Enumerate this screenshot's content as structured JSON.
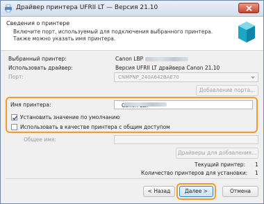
{
  "window": {
    "title": "Драйвер принтера UFRII LT — Версия 21.10"
  },
  "header": {
    "title": "Сведения о принтере",
    "description": "Включите порт, используемый для подключения выбранного принтера. Также можно указать имя принтера."
  },
  "info": {
    "selected_printer_label": "Выбранный принтер:",
    "selected_printer_value": "Canon LBP",
    "driver_label": "Использовать драйвер:",
    "driver_value": "Версия UFRII LT драйвера Canon 21.10",
    "port_label": "Порт:",
    "port_value": "CNMPNP_240A642BAE70",
    "add_port_button": "Добавление порта..."
  },
  "printer_name": {
    "label": "Имя принтера:",
    "value": "Canon LBP",
    "default_checkbox": "Установить значение по умолчанию",
    "default_checked": true,
    "shared_checkbox": "Использовать в качестве принтера с общим доступом",
    "shared_checked": false
  },
  "share": {
    "label": "Общее имя:",
    "drivers_button": "Драйверы для добавления..."
  },
  "summary": {
    "current_label": "Текущий принтер:",
    "current_value": "1",
    "count_label": "Количество принтеров для установки:",
    "count_value": "1"
  },
  "footer": {
    "back": "< Назад",
    "next": "Далее >",
    "cancel": "Отмена"
  },
  "colors": {
    "highlight": "#f29b2a",
    "title_bg": "#d3deec",
    "close": "#c7452b"
  }
}
